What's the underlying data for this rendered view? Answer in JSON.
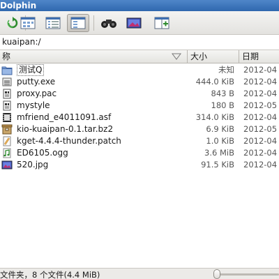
{
  "window": {
    "title": "Dolphin"
  },
  "toolbar": {
    "buttons": [
      {
        "icon": "reload-icon"
      },
      {
        "icon": "icons-view-icon"
      },
      {
        "icon": "details-view-icon"
      },
      {
        "icon": "compact-view-icon",
        "active": true
      },
      {
        "icon": "binoculars-icon"
      },
      {
        "icon": "preview-icon"
      },
      {
        "icon": "split-view-icon"
      }
    ]
  },
  "location": {
    "path": "kuaipan:/"
  },
  "columns": {
    "name": "称",
    "size": "大小",
    "date": "日期"
  },
  "files": [
    {
      "name": "测试Q",
      "size": "未知",
      "date": "2012-04",
      "icon": "folder-icon"
    },
    {
      "name": "putty.exe",
      "size": "444.0 KiB",
      "date": "2012-04",
      "icon": "executable-icon"
    },
    {
      "name": "proxy.pac",
      "size": "843 B",
      "date": "2012-04",
      "icon": "text-file-icon"
    },
    {
      "name": "mystyle",
      "size": "180 B",
      "date": "2012-05",
      "icon": "text-file-icon"
    },
    {
      "name": "mfriend_e4011091.asf",
      "size": "314.0 KiB",
      "date": "2012-04",
      "icon": "video-file-icon"
    },
    {
      "name": "kio-kuaipan-0.1.tar.bz2",
      "size": "6.9 KiB",
      "date": "2012-05",
      "icon": "archive-icon"
    },
    {
      "name": "kget-4.4.4-thunder.patch",
      "size": "1.0 KiB",
      "date": "2012-04",
      "icon": "patch-file-icon"
    },
    {
      "name": "ED6105.ogg",
      "size": "3.6 MiB",
      "date": "2012-04",
      "icon": "audio-file-icon"
    },
    {
      "name": "520.jpg",
      "size": "91.5 KiB",
      "date": "2012-04",
      "icon": "image-file-icon"
    }
  ],
  "status": {
    "text": "文件夹，8 个文件(4.4 MiB)"
  },
  "colors": {
    "titlebar": "#2f68ae",
    "toolbar": "#e9e8e5",
    "accent": "#3a9a3a"
  }
}
